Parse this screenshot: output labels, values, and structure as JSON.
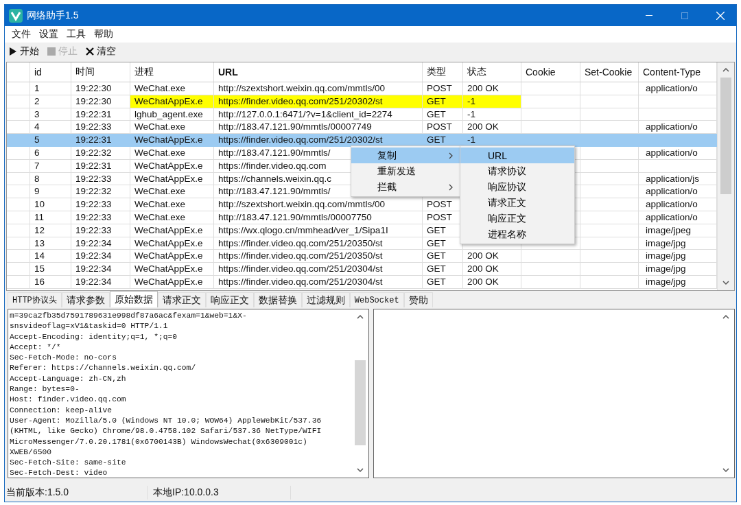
{
  "window": {
    "title": "网络助手1.5"
  },
  "menu_bar": [
    "文件",
    "设置",
    "工具",
    "帮助"
  ],
  "toolbar": [
    {
      "kind": "play",
      "label": "开始",
      "disabled": false
    },
    {
      "kind": "stop",
      "label": "停止",
      "disabled": true
    },
    {
      "kind": "clear",
      "label": "清空",
      "disabled": false
    }
  ],
  "table": {
    "columns": [
      "id",
      "时间",
      "进程",
      "URL",
      "类型",
      "状态",
      "Cookie",
      "Set-Cookie",
      "Content-Type"
    ],
    "rows": [
      {
        "id": "1",
        "time": "19:22:30",
        "process": "WeChat.exe",
        "url": "http://szextshort.weixin.qq.com/mmtls/00",
        "type": "POST",
        "status": "200 OK",
        "content_type": "application/o",
        "selected": false,
        "highlighted": false
      },
      {
        "id": "2",
        "time": "19:22:30",
        "process": "WeChatAppEx.e",
        "url": "https://finder.video.qq.com/251/20302/st",
        "type": "GET",
        "status": "-1",
        "selected": false,
        "highlighted": true
      },
      {
        "id": "3",
        "time": "19:22:31",
        "process": "lghub_agent.exe",
        "url": "http://127.0.0.1:6471/?v=1&client_id=2274",
        "type": "GET",
        "status": "-1",
        "selected": false,
        "highlighted": false
      },
      {
        "id": "4",
        "time": "19:22:33",
        "process": "WeChat.exe",
        "url": "http://183.47.121.90/mmtls/00007749",
        "type": "POST",
        "status": "200 OK",
        "content_type": "application/o",
        "selected": false,
        "highlighted": false
      },
      {
        "id": "5",
        "time": "19:22:31",
        "process": "WeChatAppEx.e",
        "url": "https://finder.video.qq.com/251/20302/st",
        "type": "GET",
        "status": "-1",
        "selected": true,
        "highlighted": false
      },
      {
        "id": "6",
        "time": "19:22:32",
        "process": "WeChat.exe",
        "url": "http://183.47.121.90/mmtls/",
        "content_type": "application/o",
        "selected": false,
        "highlighted": false
      },
      {
        "id": "7",
        "time": "19:22:31",
        "process": "WeChatAppEx.e",
        "url": "https://finder.video.qq.com",
        "selected": false,
        "highlighted": false
      },
      {
        "id": "8",
        "time": "19:22:33",
        "process": "WeChatAppEx.e",
        "url": "https://channels.weixin.qq.c",
        "content_type": "application/js",
        "selected": false,
        "highlighted": false
      },
      {
        "id": "9",
        "time": "19:22:32",
        "process": "WeChat.exe",
        "url": "http://183.47.121.90/mmtls/",
        "content_type": "application/o",
        "selected": false,
        "highlighted": false
      },
      {
        "id": "10",
        "time": "19:22:33",
        "process": "WeChat.exe",
        "url": "http://szextshort.weixin.qq.com/mmtls/00",
        "type": "POST",
        "content_type": "application/o",
        "selected": false,
        "highlighted": false
      },
      {
        "id": "11",
        "time": "19:22:33",
        "process": "WeChat.exe",
        "url": "http://183.47.121.90/mmtls/00007750",
        "type": "POST",
        "content_type": "application/o",
        "selected": false,
        "highlighted": false
      },
      {
        "id": "12",
        "time": "19:22:33",
        "process": "WeChatAppEx.e",
        "url": "https://wx.qlogo.cn/mmhead/ver_1/Sipa1I",
        "type": "GET",
        "content_type": "image/jpeg",
        "selected": false,
        "highlighted": false
      },
      {
        "id": "13",
        "time": "19:22:34",
        "process": "WeChatAppEx.e",
        "url": "https://finder.video.qq.com/251/20350/st",
        "type": "GET",
        "content_type": "image/jpg",
        "selected": false,
        "highlighted": false
      },
      {
        "id": "14",
        "time": "19:22:34",
        "process": "WeChatAppEx.e",
        "url": "https://finder.video.qq.com/251/20350/st",
        "type": "GET",
        "status": "200 OK",
        "content_type": "image/jpg",
        "selected": false,
        "highlighted": false
      },
      {
        "id": "15",
        "time": "19:22:34",
        "process": "WeChatAppEx.e",
        "url": "https://finder.video.qq.com/251/20304/st",
        "type": "GET",
        "status": "200 OK",
        "content_type": "image/jpg",
        "selected": false,
        "highlighted": false
      },
      {
        "id": "16",
        "time": "19:22:34",
        "process": "WeChatAppEx.e",
        "url": "https://finder.video.qq.com/251/20304/st",
        "type": "GET",
        "status": "200 OK",
        "content_type": "image/jpg",
        "selected": false,
        "highlighted": false
      }
    ]
  },
  "context_menu": {
    "items": [
      {
        "label": "复制",
        "has_submenu": true,
        "selected": true
      },
      {
        "label": "重新发送",
        "has_submenu": false,
        "selected": false
      },
      {
        "label": "拦截",
        "has_submenu": true,
        "selected": false
      }
    ],
    "submenu": [
      {
        "label": "URL",
        "selected": true
      },
      {
        "label": "请求协议",
        "selected": false
      },
      {
        "label": "响应协议",
        "selected": false
      },
      {
        "label": "请求正文",
        "selected": false
      },
      {
        "label": "响应正文",
        "selected": false
      },
      {
        "label": "进程名称",
        "selected": false
      }
    ]
  },
  "tabs": [
    {
      "label": "HTTP协议头",
      "selected": false
    },
    {
      "label": "请求参数",
      "selected": false
    },
    {
      "label": "原始数据",
      "selected": true
    },
    {
      "label": "请求正文",
      "selected": false
    },
    {
      "label": "响应正文",
      "selected": false
    },
    {
      "label": "数据替换",
      "selected": false
    },
    {
      "label": "过滤规则",
      "selected": false
    },
    {
      "label": "WebSocket",
      "selected": false
    },
    {
      "label": "赞助",
      "selected": false
    }
  ],
  "raw_data": [
    "m=39ca2fb35d7591789631e998df87a6ac&fexam=1&web=1&X-",
    "snsvideoflag=xV1&taskid=0 HTTP/1.1",
    "Accept-Encoding: identity;q=1, *;q=0",
    "Accept: */*",
    "Sec-Fetch-Mode: no-cors",
    "Referer: https://channels.weixin.qq.com/",
    "Accept-Language: zh-CN,zh",
    "Range: bytes=0-",
    "Host: finder.video.qq.com",
    "Connection: keep-alive",
    "User-Agent: Mozilla/5.0 (Windows NT 10.0; WOW64) AppleWebKit/537.36",
    "(KHTML, like Gecko) Chrome/98.0.4758.102 Safari/537.36 NetType/WIFI",
    "MicroMessenger/7.0.20.1781(0x6700143B) WindowsWechat(0x6309001c)",
    "XWEB/6500",
    "Sec-Fetch-Site: same-site",
    "Sec-Fetch-Dest: video"
  ],
  "status_bar": [
    "当前版本:1.5.0",
    "本地IP:10.0.0.3"
  ]
}
